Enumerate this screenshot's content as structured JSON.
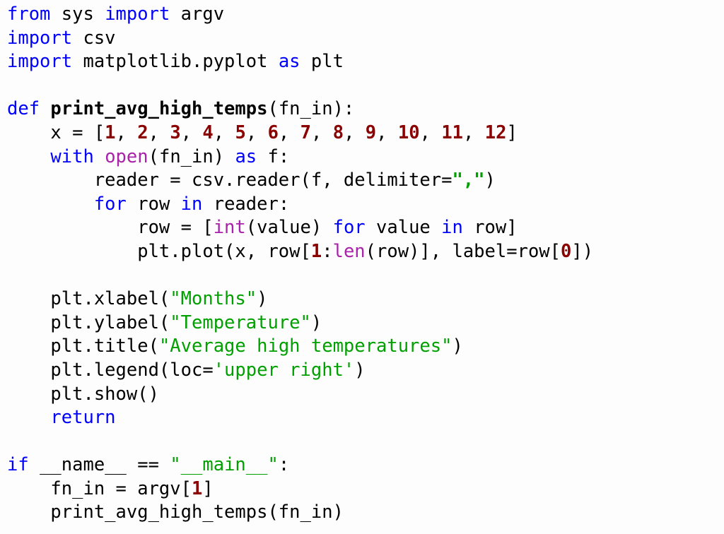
{
  "document": {
    "kind": "python-source-listing",
    "language": "Python",
    "background_color": "#fdfdfd",
    "colors": {
      "plain": "#000000",
      "keyword": "#0000ff",
      "builtin": "#aa22aa",
      "string": "#00a000",
      "number": "#8b0000"
    }
  },
  "code": {
    "lines": [
      {
        "number": 1,
        "text": "from sys import argv",
        "tokens": [
          {
            "text": "from",
            "type": "keyword"
          },
          {
            "text": " sys ",
            "type": "plain"
          },
          {
            "text": "import",
            "type": "keyword"
          },
          {
            "text": " argv",
            "type": "plain"
          }
        ]
      },
      {
        "number": 2,
        "text": "import csv",
        "tokens": [
          {
            "text": "import",
            "type": "keyword"
          },
          {
            "text": " csv",
            "type": "plain"
          }
        ]
      },
      {
        "number": 3,
        "text": "import matplotlib.pyplot as plt",
        "tokens": [
          {
            "text": "import",
            "type": "keyword"
          },
          {
            "text": " matplotlib.pyplot ",
            "type": "plain"
          },
          {
            "text": "as",
            "type": "keyword"
          },
          {
            "text": " plt",
            "type": "plain"
          }
        ]
      },
      {
        "number": 4,
        "text": "",
        "tokens": []
      },
      {
        "number": 5,
        "text": "def print_avg_high_temps(fn_in):",
        "tokens": [
          {
            "text": "def",
            "type": "keyword"
          },
          {
            "text": " ",
            "type": "plain"
          },
          {
            "text": "print_avg_high_temps",
            "type": "funcname"
          },
          {
            "text": "(fn_in):",
            "type": "plain"
          }
        ]
      },
      {
        "number": 6,
        "text": "    x = [1, 2, 3, 4, 5, 6, 7, 8, 9, 10, 11, 12]",
        "tokens": [
          {
            "text": "    x = [",
            "type": "plain"
          },
          {
            "text": "1",
            "type": "number"
          },
          {
            "text": ", ",
            "type": "plain"
          },
          {
            "text": "2",
            "type": "number"
          },
          {
            "text": ", ",
            "type": "plain"
          },
          {
            "text": "3",
            "type": "number"
          },
          {
            "text": ", ",
            "type": "plain"
          },
          {
            "text": "4",
            "type": "number"
          },
          {
            "text": ", ",
            "type": "plain"
          },
          {
            "text": "5",
            "type": "number"
          },
          {
            "text": ", ",
            "type": "plain"
          },
          {
            "text": "6",
            "type": "number"
          },
          {
            "text": ", ",
            "type": "plain"
          },
          {
            "text": "7",
            "type": "number"
          },
          {
            "text": ", ",
            "type": "plain"
          },
          {
            "text": "8",
            "type": "number"
          },
          {
            "text": ", ",
            "type": "plain"
          },
          {
            "text": "9",
            "type": "number"
          },
          {
            "text": ", ",
            "type": "plain"
          },
          {
            "text": "10",
            "type": "number"
          },
          {
            "text": ", ",
            "type": "plain"
          },
          {
            "text": "11",
            "type": "number"
          },
          {
            "text": ", ",
            "type": "plain"
          },
          {
            "text": "12",
            "type": "number"
          },
          {
            "text": "]",
            "type": "plain"
          }
        ]
      },
      {
        "number": 7,
        "text": "    with open(fn_in) as f:",
        "tokens": [
          {
            "text": "    ",
            "type": "plain"
          },
          {
            "text": "with",
            "type": "keyword"
          },
          {
            "text": " ",
            "type": "plain"
          },
          {
            "text": "open",
            "type": "builtin"
          },
          {
            "text": "(fn_in) ",
            "type": "plain"
          },
          {
            "text": "as",
            "type": "keyword"
          },
          {
            "text": " f:",
            "type": "plain"
          }
        ]
      },
      {
        "number": 8,
        "text": "        reader = csv.reader(f, delimiter=\",\")",
        "tokens": [
          {
            "text": "        reader = csv.reader(f, delimiter=",
            "type": "plain"
          },
          {
            "text": "\",\"",
            "type": "strbold"
          },
          {
            "text": ")",
            "type": "plain"
          }
        ]
      },
      {
        "number": 9,
        "text": "        for row in reader:",
        "tokens": [
          {
            "text": "        ",
            "type": "plain"
          },
          {
            "text": "for",
            "type": "keyword"
          },
          {
            "text": " row ",
            "type": "plain"
          },
          {
            "text": "in",
            "type": "keyword"
          },
          {
            "text": " reader:",
            "type": "plain"
          }
        ]
      },
      {
        "number": 10,
        "text": "            row = [int(value) for value in row]",
        "tokens": [
          {
            "text": "            row = [",
            "type": "plain"
          },
          {
            "text": "int",
            "type": "builtin"
          },
          {
            "text": "(value) ",
            "type": "plain"
          },
          {
            "text": "for",
            "type": "keyword"
          },
          {
            "text": " value ",
            "type": "plain"
          },
          {
            "text": "in",
            "type": "keyword"
          },
          {
            "text": " row]",
            "type": "plain"
          }
        ]
      },
      {
        "number": 11,
        "text": "            plt.plot(x, row[1:len(row)], label=row[0])",
        "tokens": [
          {
            "text": "            plt.plot(x, row[",
            "type": "plain"
          },
          {
            "text": "1",
            "type": "number"
          },
          {
            "text": ":",
            "type": "plain"
          },
          {
            "text": "len",
            "type": "builtin"
          },
          {
            "text": "(row)], label=row[",
            "type": "plain"
          },
          {
            "text": "0",
            "type": "number"
          },
          {
            "text": "])",
            "type": "plain"
          }
        ]
      },
      {
        "number": 12,
        "text": "",
        "tokens": []
      },
      {
        "number": 13,
        "text": "    plt.xlabel(\"Months\")",
        "tokens": [
          {
            "text": "    plt.xlabel(",
            "type": "plain"
          },
          {
            "text": "\"Months\"",
            "type": "string"
          },
          {
            "text": ")",
            "type": "plain"
          }
        ]
      },
      {
        "number": 14,
        "text": "    plt.ylabel(\"Temperature\")",
        "tokens": [
          {
            "text": "    plt.ylabel(",
            "type": "plain"
          },
          {
            "text": "\"Temperature\"",
            "type": "string"
          },
          {
            "text": ")",
            "type": "plain"
          }
        ]
      },
      {
        "number": 15,
        "text": "    plt.title(\"Average high temperatures\")",
        "tokens": [
          {
            "text": "    plt.title(",
            "type": "plain"
          },
          {
            "text": "\"Average high temperatures\"",
            "type": "string"
          },
          {
            "text": ")",
            "type": "plain"
          }
        ]
      },
      {
        "number": 16,
        "text": "    plt.legend(loc='upper right')",
        "tokens": [
          {
            "text": "    plt.legend(loc=",
            "type": "plain"
          },
          {
            "text": "'upper right'",
            "type": "string"
          },
          {
            "text": ")",
            "type": "plain"
          }
        ]
      },
      {
        "number": 17,
        "text": "    plt.show()",
        "tokens": [
          {
            "text": "    plt.show()",
            "type": "plain"
          }
        ]
      },
      {
        "number": 18,
        "text": "    return",
        "tokens": [
          {
            "text": "    ",
            "type": "plain"
          },
          {
            "text": "return",
            "type": "keyword"
          }
        ]
      },
      {
        "number": 19,
        "text": "",
        "tokens": []
      },
      {
        "number": 20,
        "text": "if __name__ == \"__main__\":",
        "tokens": [
          {
            "text": "if",
            "type": "keyword"
          },
          {
            "text": " __name__ == ",
            "type": "plain"
          },
          {
            "text": "\"__main__\"",
            "type": "string"
          },
          {
            "text": ":",
            "type": "plain"
          }
        ]
      },
      {
        "number": 21,
        "text": "    fn_in = argv[1]",
        "tokens": [
          {
            "text": "    fn_in = argv[",
            "type": "plain"
          },
          {
            "text": "1",
            "type": "number"
          },
          {
            "text": "]",
            "type": "plain"
          }
        ]
      },
      {
        "number": 22,
        "text": "    print_avg_high_temps(fn_in)",
        "tokens": [
          {
            "text": "    print_avg_high_temps(fn_in)",
            "type": "plain"
          }
        ]
      }
    ]
  }
}
